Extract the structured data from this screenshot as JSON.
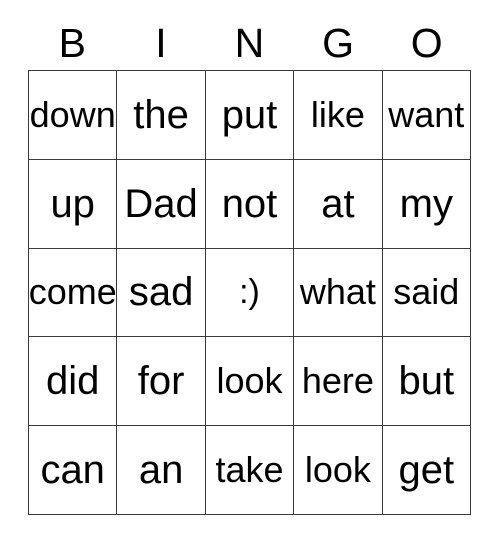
{
  "card": {
    "title_letters": [
      "B",
      "I",
      "N",
      "G",
      "O"
    ],
    "columns": 5,
    "rows": 5,
    "border_color": "#3a3a3a",
    "background_color": "#ffffff",
    "text_color": "#000000",
    "free_space_text": ":)"
  },
  "grid": [
    [
      {
        "text": "down"
      },
      {
        "text": "the"
      },
      {
        "text": "put"
      },
      {
        "text": "like"
      },
      {
        "text": "want"
      }
    ],
    [
      {
        "text": "up"
      },
      {
        "text": "Dad"
      },
      {
        "text": "not"
      },
      {
        "text": "at"
      },
      {
        "text": "my"
      }
    ],
    [
      {
        "text": "come"
      },
      {
        "text": "sad"
      },
      {
        "text": ":)"
      },
      {
        "text": "what"
      },
      {
        "text": "said"
      }
    ],
    [
      {
        "text": "did"
      },
      {
        "text": "for"
      },
      {
        "text": "look"
      },
      {
        "text": "here"
      },
      {
        "text": "but"
      }
    ],
    [
      {
        "text": "can"
      },
      {
        "text": "an"
      },
      {
        "text": "take"
      },
      {
        "text": "look"
      },
      {
        "text": "get"
      }
    ]
  ]
}
